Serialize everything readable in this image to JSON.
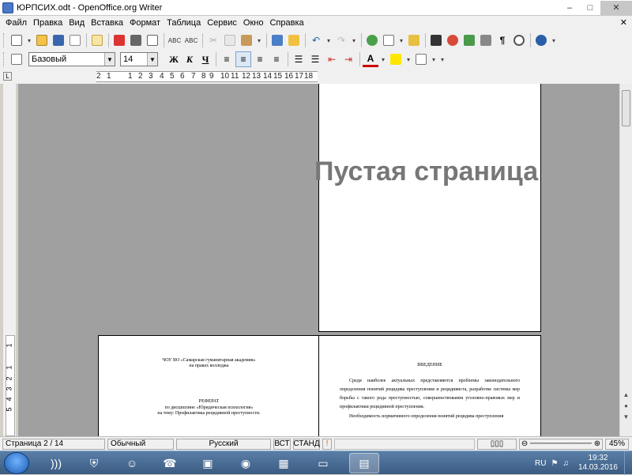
{
  "window": {
    "title": "ЮРПСИХ.odt - OpenOffice.org Writer",
    "minimize": "–",
    "maximize": "□",
    "close": "✕"
  },
  "menu": {
    "items": [
      "Файл",
      "Правка",
      "Вид",
      "Вставка",
      "Формат",
      "Таблица",
      "Сервис",
      "Окно",
      "Справка"
    ],
    "close_doc": "✕"
  },
  "formatting": {
    "style": "Базовый",
    "size": "14",
    "bold": "Ж",
    "italic": "К",
    "underline": "Ч"
  },
  "ruler": {
    "corner": "L",
    "numbers": [
      "2",
      "1",
      "1",
      "2",
      "3",
      "4",
      "5",
      "6",
      "7",
      "8",
      "9",
      "10",
      "11",
      "12",
      "13",
      "14",
      "15",
      "16",
      "17",
      "18"
    ],
    "vertical_numbers": [
      "1",
      "1",
      "2",
      "3",
      "4",
      "5"
    ]
  },
  "document": {
    "blank_page_text": "Пустая страница",
    "title_page": {
      "org_line1": "ЧОУ ВО «Самарская гуманитарная академия»",
      "org_line2": "на правах колледжа",
      "heading": "РЕФЕРАТ",
      "line1": "по дисциплине «Юридическая психология»",
      "line2": "на тему: Профилактика рецидивной преступности."
    },
    "intro_page": {
      "heading": "ВВЕДЕНИЕ",
      "para1": "Среди наиболее актуальных представляются проблемы законодательного определения понятий рецидива преступления и рецидивиста, разработке системы мер борьбы с такого рода преступностью, совершенствования уголовно-правовых мер и профилактики рецидивной преступления.",
      "para2": "Необходимость нормативного определения понятий рецидива преступления"
    }
  },
  "status": {
    "page": "Страница  2 / 14",
    "style": "Обычный",
    "language": "Русский",
    "insert_mode": "ВСТ",
    "selection_mode": "СТАНД",
    "zoom": "45%"
  },
  "taskbar": {
    "language": "RU",
    "time": "19:32",
    "date": "14.03.2016"
  },
  "colors": {
    "workspace": "#a0a0a0",
    "taskbar": "#3b5b82"
  }
}
